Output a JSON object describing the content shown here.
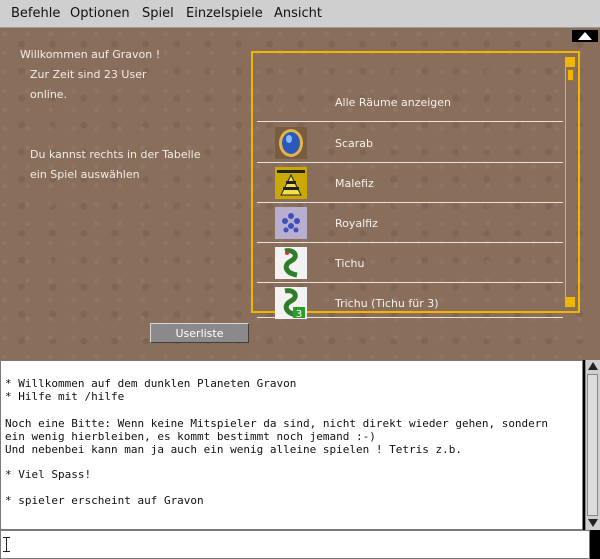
{
  "menu": [
    "Befehle",
    "Optionen",
    "Spiel",
    "Einzelspiele",
    "Ansicht"
  ],
  "welcome": {
    "line1": "Willkommen auf Gravon !",
    "line2": "Zur Zeit sind 23 User",
    "line3": "online.",
    "line4": "Du kannst rechts in der Tabelle",
    "line5": "ein Spiel auswählen"
  },
  "rooms": [
    {
      "label": "Alle Räume anzeigen",
      "icon": "none"
    },
    {
      "label": "Scarab",
      "icon": "scarab-icon"
    },
    {
      "label": "Malefiz",
      "icon": "malefiz-icon"
    },
    {
      "label": "Royalfiz",
      "icon": "royalfiz-icon"
    },
    {
      "label": "Tichu",
      "icon": "tichu-icon"
    },
    {
      "label": "Trichu (Tichu für 3)",
      "icon": "trichu-icon"
    }
  ],
  "buttons": {
    "userliste": "Userliste"
  },
  "console": [
    "* Willkommen auf dem dunklen Planeten Gravon",
    "* Hilfe mit /hilfe",
    "Noch eine Bitte: Wenn keine Mitspieler da sind, nicht direkt wieder gehen, sondern",
    "ein wenig hierbleiben, es kommt bestimmt noch jemand :-)",
    "Und nebenbei kann man ja auch ein wenig alleine spielen ! Tetris z.b.",
    "* Viel Spass!",
    "* spieler erscheint auf Gravon"
  ],
  "input": {
    "value": ""
  },
  "colors": {
    "accent": "#f1b600",
    "background": "#8a6e5c"
  }
}
